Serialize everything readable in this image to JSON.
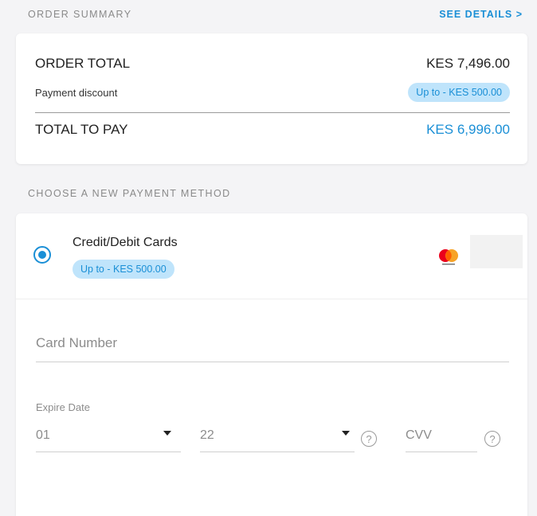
{
  "order_summary": {
    "header": "ORDER SUMMARY",
    "see_details": "SEE DETAILS >",
    "order_total_label": "ORDER TOTAL",
    "order_total_value": "KES 7,496.00",
    "payment_discount_label": "Payment discount",
    "payment_discount_value": "Up to - KES 500.00",
    "total_to_pay_label": "TOTAL TO PAY",
    "total_to_pay_value": "KES 6,996.00"
  },
  "payment": {
    "header": "CHOOSE A NEW PAYMENT METHOD",
    "method_label": "Credit/Debit Cards",
    "method_discount": "Up to - KES 500.00",
    "selected": true,
    "card_brand_icon": "mastercard-icon",
    "card_number_placeholder": "Card Number",
    "expire_label": "Expire Date",
    "expire_month": "01",
    "expire_year": "22",
    "cvv_placeholder": "CVV",
    "help_glyph": "?"
  },
  "colors": {
    "accent": "#1a8fd6",
    "pill_bg": "#bfe4fb",
    "page_bg": "#f4f4f6"
  }
}
